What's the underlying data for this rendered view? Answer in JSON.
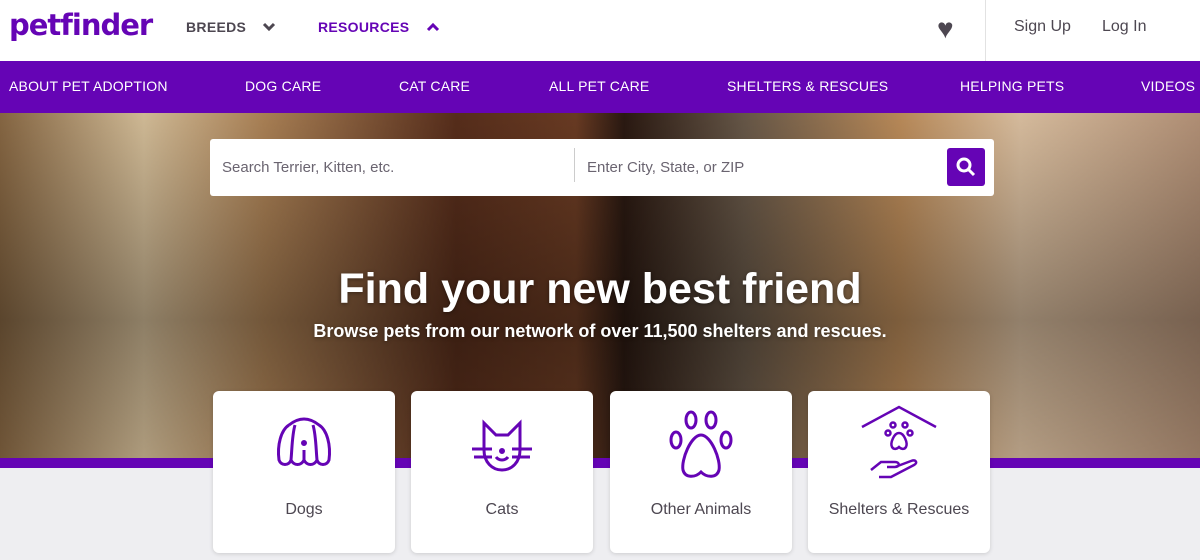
{
  "header": {
    "logo": "petfinder",
    "menu": [
      {
        "label": "BREEDS",
        "icon": "chevron-down-icon",
        "color": "#4d4751"
      },
      {
        "label": "RESOURCES",
        "icon": "chevron-up-icon",
        "color": "#6504b5"
      }
    ],
    "favorites_icon": "heart-icon",
    "sign_up": "Sign Up",
    "log_in": "Log In"
  },
  "nav": {
    "items": [
      "ABOUT PET ADOPTION",
      "DOG CARE",
      "CAT CARE",
      "ALL PET CARE",
      "SHELTERS & RESCUES",
      "HELPING PETS",
      "VIDEOS"
    ]
  },
  "search": {
    "pet_placeholder": "Search Terrier, Kitten, etc.",
    "location_placeholder": "Enter City, State, or ZIP",
    "button_icon": "search-icon"
  },
  "hero": {
    "title": "Find your new best friend",
    "subtitle": "Browse pets from our network of over 11,500 shelters and rescues."
  },
  "categories": [
    {
      "label": "Dogs",
      "icon": "dog-icon"
    },
    {
      "label": "Cats",
      "icon": "cat-icon"
    },
    {
      "label": "Other Animals",
      "icon": "paw-icon"
    },
    {
      "label": "Shelters & Rescues",
      "icon": "shelter-icon"
    }
  ],
  "colors": {
    "brand": "#6504b5"
  }
}
